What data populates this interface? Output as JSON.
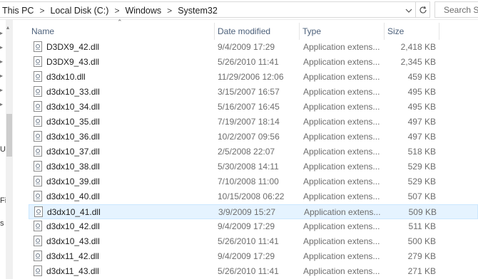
{
  "address": {
    "crumbs": [
      "This PC",
      "Local Disk (C:)",
      "Windows",
      "System32"
    ],
    "search_placeholder": "Search Sy"
  },
  "nav": {
    "labels": [
      "U",
      "Fi",
      "s"
    ]
  },
  "columns": [
    "Name",
    "Date modified",
    "Type",
    "Size"
  ],
  "files": [
    {
      "name": "D3DX9_42.dll",
      "date": "9/4/2009 17:29",
      "type": "Application extens...",
      "size": "2,418 KB"
    },
    {
      "name": "D3DX9_43.dll",
      "date": "5/26/2010 11:41",
      "type": "Application extens...",
      "size": "2,345 KB"
    },
    {
      "name": "d3dx10.dll",
      "date": "11/29/2006 12:06",
      "type": "Application extens...",
      "size": "459 KB"
    },
    {
      "name": "d3dx10_33.dll",
      "date": "3/15/2007 16:57",
      "type": "Application extens...",
      "size": "495 KB"
    },
    {
      "name": "d3dx10_34.dll",
      "date": "5/16/2007 16:45",
      "type": "Application extens...",
      "size": "495 KB"
    },
    {
      "name": "d3dx10_35.dll",
      "date": "7/19/2007 18:14",
      "type": "Application extens...",
      "size": "497 KB"
    },
    {
      "name": "d3dx10_36.dll",
      "date": "10/2/2007 09:56",
      "type": "Application extens...",
      "size": "497 KB"
    },
    {
      "name": "d3dx10_37.dll",
      "date": "2/5/2008 22:07",
      "type": "Application extens...",
      "size": "518 KB"
    },
    {
      "name": "d3dx10_38.dll",
      "date": "5/30/2008 14:11",
      "type": "Application extens...",
      "size": "529 KB"
    },
    {
      "name": "d3dx10_39.dll",
      "date": "7/10/2008 11:00",
      "type": "Application extens...",
      "size": "529 KB"
    },
    {
      "name": "d3dx10_40.dll",
      "date": "10/15/2008 06:22",
      "type": "Application extens...",
      "size": "507 KB"
    },
    {
      "name": "d3dx10_41.dll",
      "date": "3/9/2009 15:27",
      "type": "Application extens...",
      "size": "509 KB",
      "selected": true
    },
    {
      "name": "d3dx10_42.dll",
      "date": "9/4/2009 17:29",
      "type": "Application extens...",
      "size": "511 KB"
    },
    {
      "name": "d3dx10_43.dll",
      "date": "5/26/2010 11:41",
      "type": "Application extens...",
      "size": "500 KB"
    },
    {
      "name": "d3dx11_42.dll",
      "date": "9/4/2009 17:29",
      "type": "Application extens...",
      "size": "279 KB"
    },
    {
      "name": "d3dx11_43.dll",
      "date": "5/26/2010 11:41",
      "type": "Application extens...",
      "size": "271 KB"
    }
  ]
}
